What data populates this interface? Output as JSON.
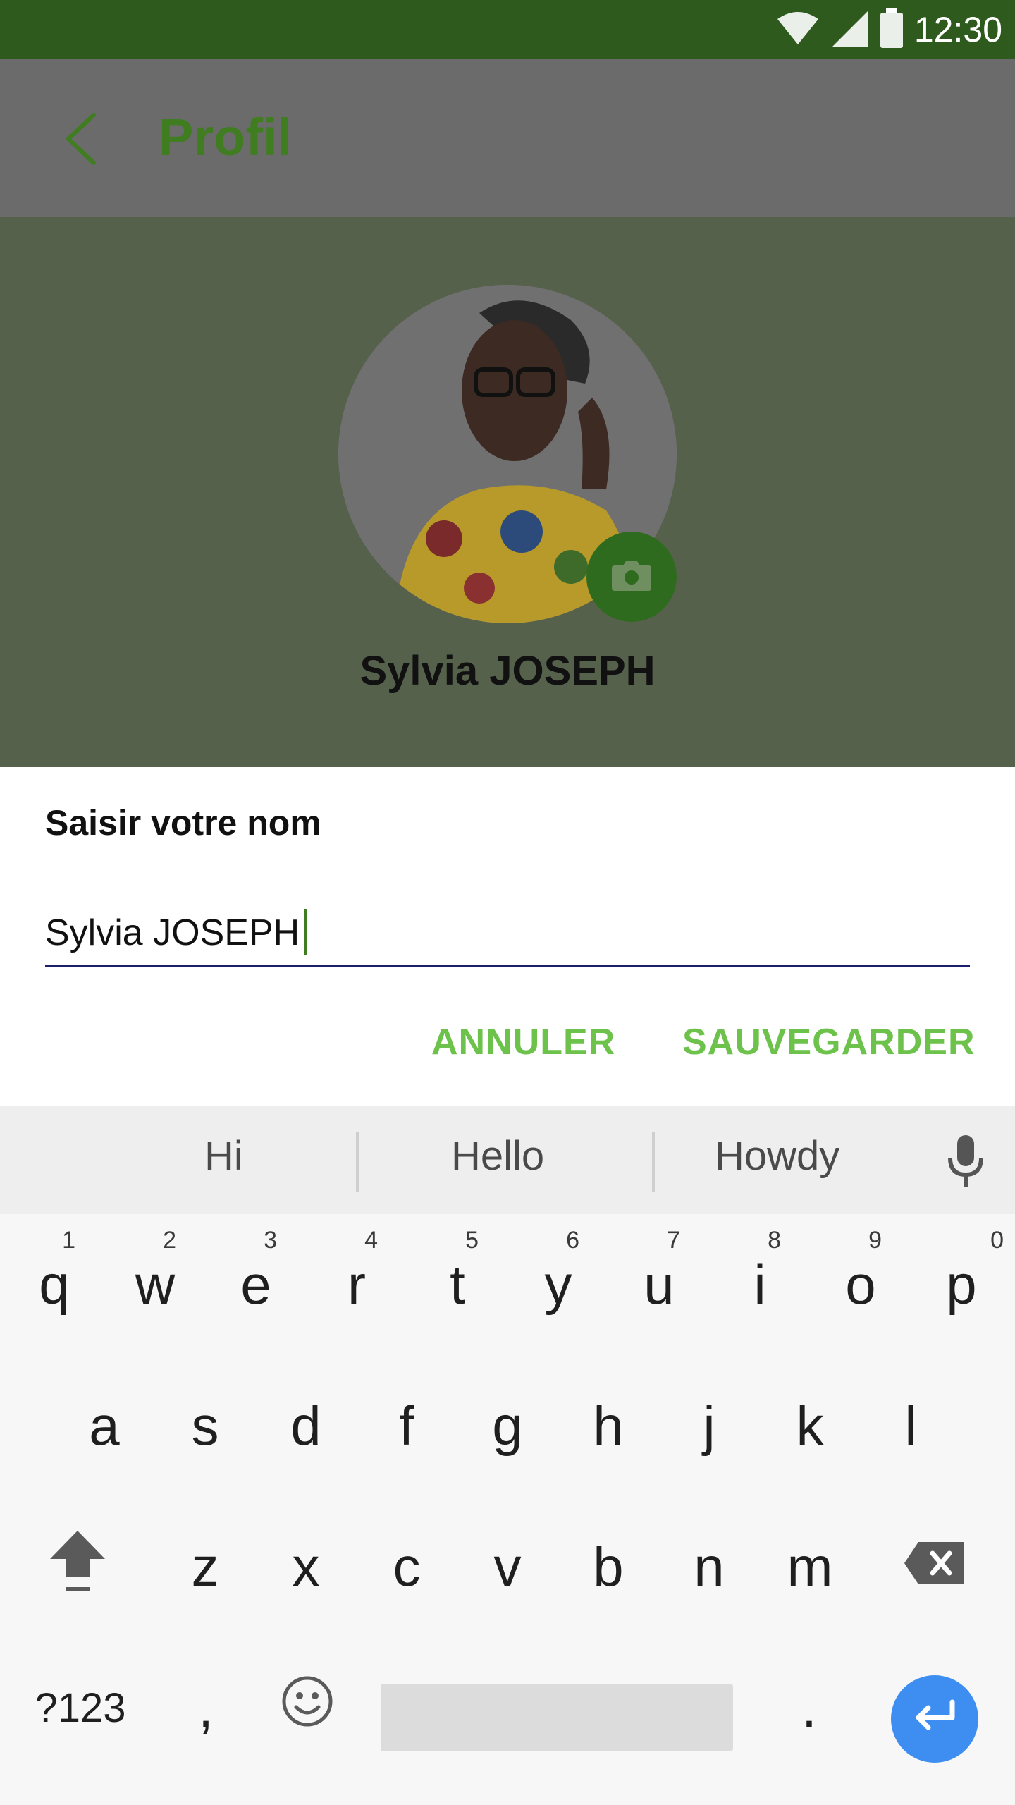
{
  "status_bar": {
    "time": "12:30"
  },
  "app_bar": {
    "title": "Profil"
  },
  "profile": {
    "name": "Sylvia JOSEPH"
  },
  "dialog": {
    "title": "Saisir votre nom",
    "input_value": "Sylvia JOSEPH",
    "cancel_label": "ANNULER",
    "save_label": "SAUVEGARDER"
  },
  "keyboard": {
    "suggestions": [
      "Hi",
      "Hello",
      "Howdy"
    ],
    "row1": [
      {
        "key": "q",
        "hint": "1"
      },
      {
        "key": "w",
        "hint": "2"
      },
      {
        "key": "e",
        "hint": "3"
      },
      {
        "key": "r",
        "hint": "4"
      },
      {
        "key": "t",
        "hint": "5"
      },
      {
        "key": "y",
        "hint": "6"
      },
      {
        "key": "u",
        "hint": "7"
      },
      {
        "key": "i",
        "hint": "8"
      },
      {
        "key": "o",
        "hint": "9"
      },
      {
        "key": "p",
        "hint": "0"
      }
    ],
    "row2": [
      "a",
      "s",
      "d",
      "f",
      "g",
      "h",
      "j",
      "k",
      "l"
    ],
    "row3": [
      "z",
      "x",
      "c",
      "v",
      "b",
      "n",
      "m"
    ],
    "symbols_label": "?123",
    "comma": ",",
    "period": "."
  },
  "colors": {
    "status_bar": "#2f5a1e",
    "accent_green": "#3f7d20",
    "button_green": "#6dc24b",
    "enter_blue": "#3d8ef0"
  }
}
